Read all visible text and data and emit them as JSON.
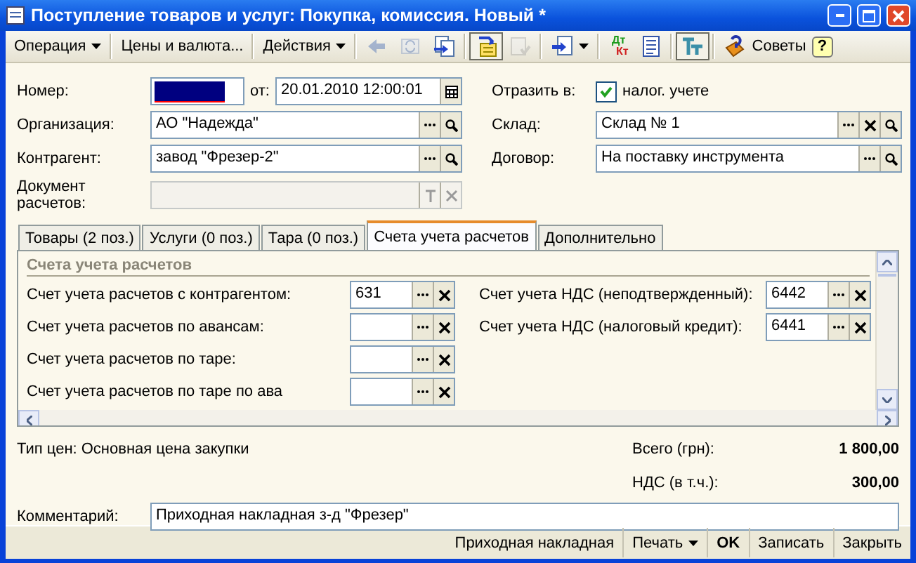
{
  "window": {
    "title": "Поступление товаров и услуг: Покупка, комиссия. Новый *"
  },
  "toolbar": [
    {
      "kind": "menu",
      "label": "Операция"
    },
    {
      "kind": "separator"
    },
    {
      "kind": "text",
      "label": "Цены и валюта..."
    },
    {
      "kind": "separator"
    },
    {
      "kind": "menu",
      "label": "Действия"
    },
    {
      "kind": "separator"
    },
    {
      "kind": "icon",
      "disabled": true,
      "pressed": false
    },
    {
      "kind": "icon",
      "disabled": true,
      "pressed": false
    },
    {
      "kind": "icon",
      "disabled": false,
      "pressed": false
    },
    {
      "kind": "separator"
    },
    {
      "kind": "icon",
      "disabled": false,
      "pressed": true
    },
    {
      "kind": "icon",
      "disabled": true,
      "pressed": false
    },
    {
      "kind": "separator"
    },
    {
      "kind": "icon_menu",
      "disabled": false,
      "pressed": false
    },
    {
      "kind": "separator"
    },
    {
      "kind": "dtkt",
      "top": "Дт",
      "bottom": "Кт"
    },
    {
      "kind": "icon",
      "disabled": false,
      "pressed": false
    },
    {
      "kind": "separator"
    },
    {
      "kind": "icon",
      "disabled": false,
      "pressed": true
    },
    {
      "kind": "separator"
    },
    {
      "kind": "icon_text",
      "label": "Советы"
    },
    {
      "kind": "help",
      "label": "?"
    }
  ],
  "header": {
    "number": {
      "label": "Номер:",
      "selected": true
    },
    "date": {
      "label": "от:",
      "value": "20.01.2010 12:00:01"
    },
    "reflect": {
      "label": "Отразить в:",
      "checkbox_label": "налог. учете",
      "checked": true
    },
    "fields": [
      {
        "label": "Организация:",
        "value": "АО \"Надежда\"",
        "choice_button": true,
        "search_button": true
      },
      {
        "label": "Склад:",
        "value": "Склад № 1",
        "choice_button": true,
        "clear_button": true,
        "search_button": true
      },
      {
        "label": "Контрагент:",
        "value": "завод \"Фрезер-2\"",
        "choice_button": true,
        "search_button": true
      },
      {
        "label": "Договор:",
        "value": "На поставку инструмента",
        "choice_button": true,
        "search_button": true
      },
      {
        "label": "Документ расчетов:",
        "disabled": true,
        "text_button": true,
        "clear_button": true
      }
    ]
  },
  "tabs": [
    {
      "label": "Товары (2 поз.)",
      "selected": false
    },
    {
      "label": "Услуги (0 поз.)",
      "selected": false
    },
    {
      "label": "Тара (0 поз.)",
      "selected": false
    },
    {
      "label": "Счета учета расчетов",
      "selected": true
    },
    {
      "label": "Дополнительно",
      "selected": false
    }
  ],
  "accounts": {
    "title": "Счета учета расчетов",
    "left": [
      {
        "label": "Счет учета расчетов с контрагентом:",
        "value": "631"
      },
      {
        "label": "Счет учета расчетов по авансам:"
      },
      {
        "label": "Счет учета расчетов по таре:"
      },
      {
        "label": "Счет учета расчетов по таре по ава"
      }
    ],
    "right": [
      {
        "label": "Счет учета НДС (неподтвержденный):",
        "value": "6442"
      },
      {
        "label": "Счет учета НДС (налоговый кредит):",
        "value": "6441"
      }
    ]
  },
  "price_type": "Тип цен: Основная цена закупки",
  "totals": [
    {
      "label": "Всего (грн):",
      "value": "1 800,00"
    },
    {
      "label": "НДС (в т.ч.):",
      "value": "300,00"
    }
  ],
  "comment": {
    "label": "Комментарий:",
    "value": "Приходная накладная з-д \"Фрезер\""
  },
  "bottom_buttons": [
    {
      "kind": "button",
      "label": "Приходная накладная"
    },
    {
      "kind": "menu",
      "label": "Печать"
    },
    {
      "kind": "default",
      "label": "OK"
    },
    {
      "kind": "button",
      "label": "Записать"
    },
    {
      "kind": "button",
      "label": "Закрыть"
    }
  ]
}
